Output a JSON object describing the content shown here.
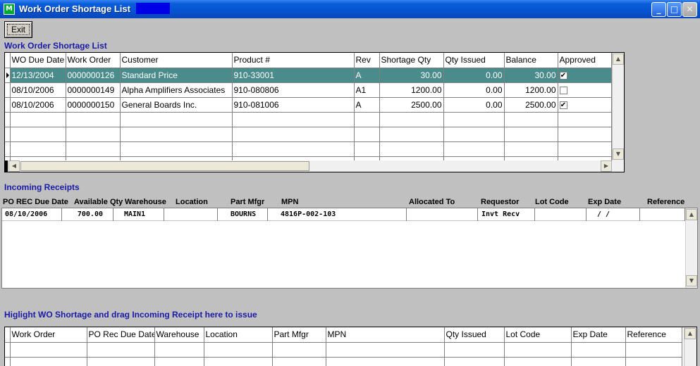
{
  "window": {
    "title": "Work Order Shortage List",
    "icon_glyph": "M"
  },
  "toolbar": {
    "exit_label": "Exit"
  },
  "wo_section": {
    "label": "Work Order Shortage List",
    "columns": [
      "WO Due Date",
      "Work Order",
      "Customer",
      "Product #",
      "Rev",
      "Shortage Qty",
      "Qty Issued",
      "Balance",
      "Approved"
    ],
    "rows": [
      {
        "due": "12/13/2004",
        "wo": "0000000126",
        "customer": "Standard Price",
        "product": "910-33001",
        "rev": "A",
        "shortage": "30.00",
        "issued": "0.00",
        "balance": "30.00",
        "approved": true,
        "selected": true
      },
      {
        "due": "08/10/2006",
        "wo": "0000000149",
        "customer": "Alpha Amplifiers Associates",
        "product": "910-080806",
        "rev": "A1",
        "shortage": "1200.00",
        "issued": "0.00",
        "balance": "1200.00",
        "approved": false,
        "selected": false
      },
      {
        "due": "08/10/2006",
        "wo": "0000000150",
        "customer": "General Boards Inc.",
        "product": "910-081006",
        "rev": "A",
        "shortage": "2500.00",
        "issued": "0.00",
        "balance": "2500.00",
        "approved": true,
        "selected": false
      }
    ]
  },
  "receipts_section": {
    "label": "Incoming Receipts",
    "columns": [
      "PO REC Due Date",
      "Available Qty",
      "Warehouse",
      "Location",
      "Part Mfgr",
      "MPN",
      "Allocated To",
      "Requestor",
      "Lot Code",
      "Exp Date",
      "Reference"
    ],
    "rows": [
      {
        "due": "08/10/2006",
        "qty": "700.00",
        "warehouse": "MAIN1",
        "location": "",
        "mfgr": "BOURNS",
        "mpn": "4816P-002-103",
        "allocated": "",
        "requestor": "Invt Recv",
        "lot": "",
        "exp": "/  /",
        "reference": ""
      }
    ]
  },
  "issue_section": {
    "label": "Higlight WO Shortage and drag Incoming Receipt here to issue",
    "columns": [
      "Work Order",
      "PO Rec Due Date",
      "Warehouse",
      "Location",
      "Part Mfgr",
      "MPN",
      "Qty Issued",
      "Lot Code",
      "Exp Date",
      "Reference"
    ]
  },
  "colors": {
    "title_bar": "#0553d1",
    "selected_row": "#4a8b8b",
    "section_label": "#1a1aa6"
  }
}
